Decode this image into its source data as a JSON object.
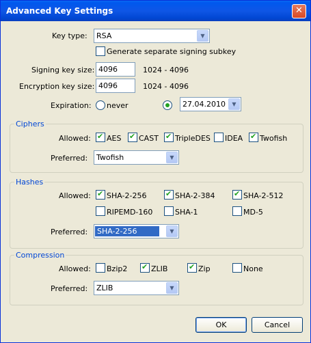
{
  "window": {
    "title": "Advanced Key Settings",
    "close_glyph": "✕"
  },
  "key": {
    "type_label": "Key type:",
    "type_value": "RSA",
    "subkey_label": "Generate separate signing subkey",
    "subkey_checked": false,
    "signing_label": "Signing key size:",
    "signing_value": "4096",
    "signing_range": "1024 - 4096",
    "encryption_label": "Encryption key size:",
    "encryption_value": "4096",
    "encryption_range": "1024 - 4096",
    "expiration_label": "Expiration:",
    "never_label": "never",
    "date_value": "27.04.2010",
    "selected_option": "date"
  },
  "ciphers": {
    "title": "Ciphers",
    "allowed_label": "Allowed:",
    "items": [
      {
        "label": "AES",
        "checked": true
      },
      {
        "label": "CAST",
        "checked": true
      },
      {
        "label": "TripleDES",
        "checked": true
      },
      {
        "label": "IDEA",
        "checked": false
      },
      {
        "label": "Twofish",
        "checked": true
      }
    ],
    "preferred_label": "Preferred:",
    "preferred_value": "Twofish"
  },
  "hashes": {
    "title": "Hashes",
    "allowed_label": "Allowed:",
    "items": [
      {
        "label": "SHA-2-256",
        "checked": true
      },
      {
        "label": "SHA-2-384",
        "checked": true
      },
      {
        "label": "SHA-2-512",
        "checked": true
      },
      {
        "label": "RIPEMD-160",
        "checked": false
      },
      {
        "label": "SHA-1",
        "checked": false
      },
      {
        "label": "MD-5",
        "checked": false
      }
    ],
    "preferred_label": "Preferred:",
    "preferred_value": "SHA-2-256"
  },
  "compression": {
    "title": "Compression",
    "allowed_label": "Allowed:",
    "items": [
      {
        "label": "Bzip2",
        "checked": false
      },
      {
        "label": "ZLIB",
        "checked": true
      },
      {
        "label": "Zip",
        "checked": true
      },
      {
        "label": "None",
        "checked": false
      }
    ],
    "preferred_label": "Preferred:",
    "preferred_value": "ZLIB"
  },
  "buttons": {
    "ok": "OK",
    "cancel": "Cancel"
  },
  "colors": {
    "titlebar": "#0058ee",
    "dialog_bg": "#ece9d8",
    "group_title": "#0046d5",
    "check": "#21a121"
  },
  "icons": {
    "check": "✔",
    "dropdown": "▼"
  }
}
